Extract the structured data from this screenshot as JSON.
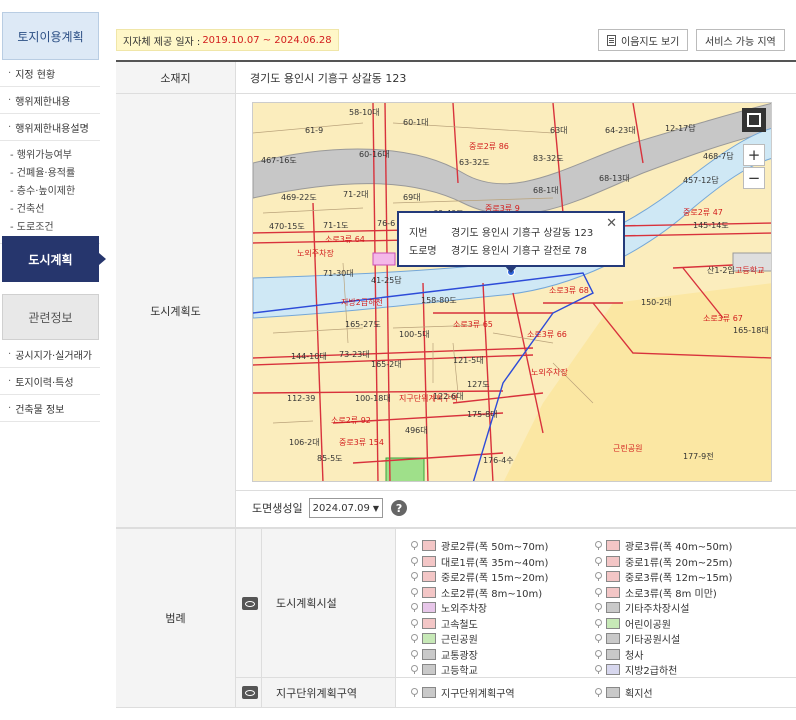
{
  "sidebar": {
    "header": "토지이용계획",
    "items": [
      {
        "label": "지정 현황"
      },
      {
        "label": "행위제한내용"
      },
      {
        "label": "행위제한내용설명"
      }
    ],
    "sub_items": [
      "행위가능여부",
      "건폐율·용적률",
      "층수·높이제한",
      "건축선",
      "도로조건"
    ],
    "active": "도시계획",
    "section2_header": "관련정보",
    "section2_items": [
      "공시지가·실거래가",
      "토지이력·특성",
      "건축물 정보"
    ]
  },
  "top": {
    "provide_label": "지자체 제공 일자 :",
    "provide_dates": "2019.10.07 ~ 2024.06.28",
    "map_button": "이음지도 보기",
    "service_button": "서비스 가능 지역"
  },
  "table": {
    "location_label": "소재지",
    "location_value": "경기도 용인시 기흥구 상갈동 123",
    "plan_label": "도시계획도",
    "legend_label": "범례",
    "date_label": "도면생성일",
    "date_value": "2024.07.09",
    "help": "?"
  },
  "popup": {
    "jibun_label": "지번",
    "jibun_value": "경기도 용인시 기흥구 상갈동 123",
    "road_label": "도로명",
    "road_value": "경기도 용인시 기흥구 갈전로 78",
    "close": "✕"
  },
  "map_controls": {
    "zoom_in": "+",
    "zoom_out": "−"
  },
  "legend": {
    "group1_label": "도시계획시설",
    "group1_left": [
      {
        "label": "광로2류(폭 50m~70m)",
        "color": "#f3c6c6"
      },
      {
        "label": "대로1류(폭 35m~40m)",
        "color": "#f3c6c6"
      },
      {
        "label": "중로2류(폭 15m~20m)",
        "color": "#f3c6c6"
      },
      {
        "label": "소로2류(폭 8m~10m)",
        "color": "#f3c6c6"
      },
      {
        "label": "노외주차장",
        "color": "#e7c6e9"
      },
      {
        "label": "고속철도",
        "color": "#f3c6c6"
      },
      {
        "label": "근린공원",
        "color": "#c7e9b7"
      },
      {
        "label": "교통광장",
        "color": "#c9c9c9"
      },
      {
        "label": "고등학교",
        "color": "#c9c9c9"
      }
    ],
    "group1_right": [
      {
        "label": "광로3류(폭 40m~50m)",
        "color": "#f3c6c6"
      },
      {
        "label": "중로1류(폭 20m~25m)",
        "color": "#f3c6c6"
      },
      {
        "label": "중로3류(폭 12m~15m)",
        "color": "#f3c6c6"
      },
      {
        "label": "소로3류(폭 8m 미만)",
        "color": "#f3c6c6"
      },
      {
        "label": "기타주차장시설",
        "color": "#c9c9c9"
      },
      {
        "label": "어린이공원",
        "color": "#c7e9b7"
      },
      {
        "label": "기타공원시설",
        "color": "#c9c9c9"
      },
      {
        "label": "청사",
        "color": "#c9c9c9"
      },
      {
        "label": "지방2급하천",
        "color": "#d7d7ee"
      }
    ],
    "group2_label": "지구단위계획구역",
    "group2_left": {
      "label": "지구단위계획구역",
      "color": "#c9c9c9"
    },
    "group2_right": {
      "label": "획지선",
      "color": "#c9c9c9"
    }
  },
  "map_labels": [
    "58-10대",
    "60-1대",
    "63대",
    "64-23대",
    "12-17답",
    "61-9",
    "60-16대",
    "중로2류 86",
    "83-32도",
    "468-7답",
    "467-16도",
    "63-32도",
    "68-13대",
    "457-12답",
    "469-22도",
    "71-2대",
    "69대",
    "68-1대",
    "중로2류 47",
    "470-15도",
    "71-1도",
    "76-6",
    "69-40도",
    "중로3류 9",
    "145-14도",
    "소로3류 64",
    "노외주차장",
    "71-30대",
    "41-25답",
    "산1-2임",
    "고등학교",
    "지방2급하천",
    "158-80도",
    "소로3류 68",
    "150-2대",
    "165-27도",
    "100-5대",
    "소로3류 65",
    "소로3류 66",
    "소로3류 67",
    "144-10대",
    "73-23대",
    "165-2대",
    "121-5대",
    "127도",
    "노외주차장",
    "165-18대",
    "112-39",
    "100-18대",
    "지구단위계획구역",
    "122-6대",
    "175-8대",
    "소로2류 92",
    "496대",
    "근린공원",
    "177-9전",
    "106-2대",
    "중로3류 154",
    "85-5도",
    "176-4수"
  ]
}
